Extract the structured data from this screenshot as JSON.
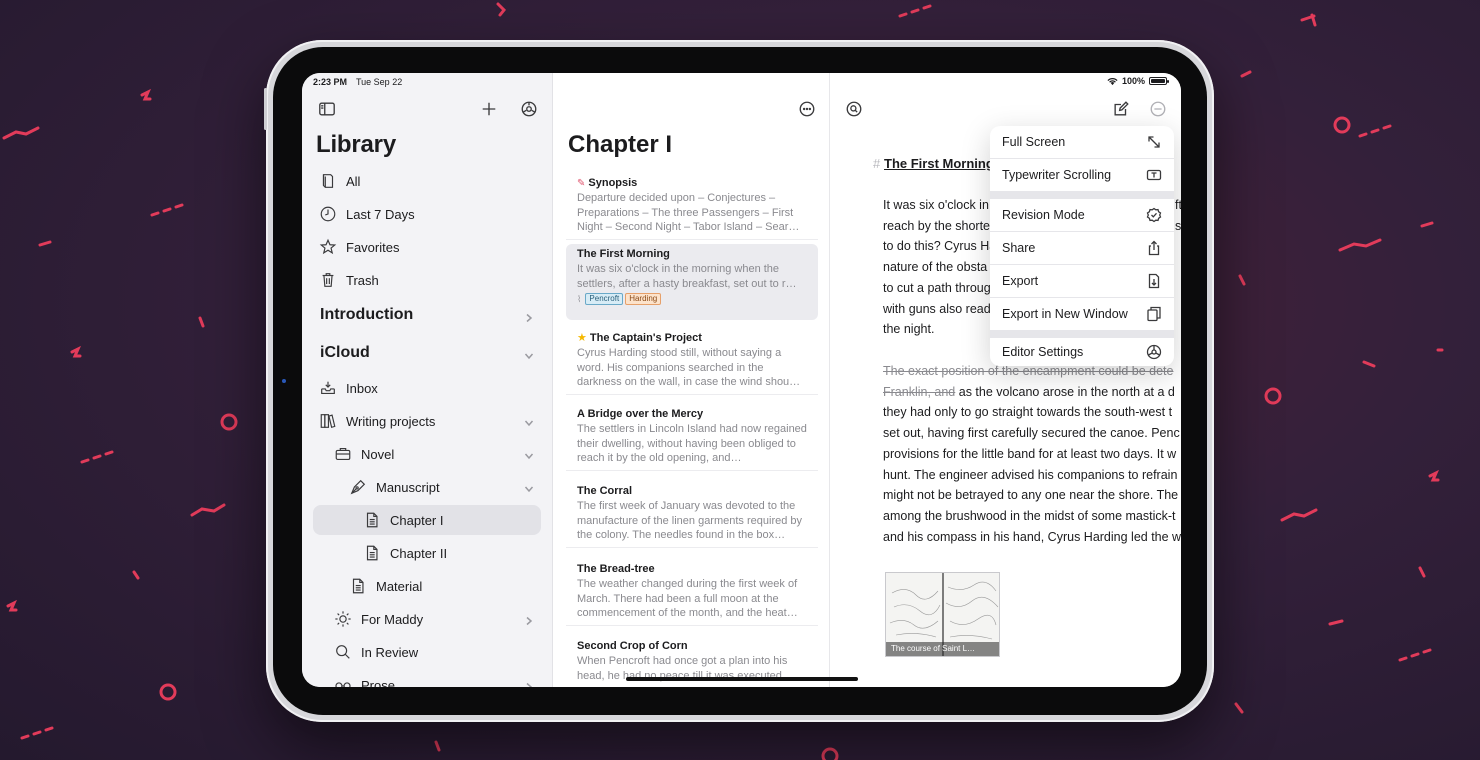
{
  "status_bar": {
    "time": "2:23 PM",
    "date": "Tue Sep 22",
    "battery": "100%"
  },
  "sidebar": {
    "title": "Library",
    "items": [
      {
        "label": "All",
        "icon": "book-icon"
      },
      {
        "label": "Last 7 Days",
        "icon": "clock-icon"
      },
      {
        "label": "Favorites",
        "icon": "star-icon"
      },
      {
        "label": "Trash",
        "icon": "trash-icon"
      },
      {
        "label": "Introduction",
        "icon": ""
      },
      {
        "label": "iCloud",
        "icon": ""
      },
      {
        "label": "Inbox",
        "icon": "inbox-icon"
      },
      {
        "label": "Writing projects",
        "icon": "books-icon"
      },
      {
        "label": "Novel",
        "icon": "briefcase-icon"
      },
      {
        "label": "Manuscript",
        "icon": "pen-nib-icon"
      },
      {
        "label": "Chapter I",
        "icon": "document-icon"
      },
      {
        "label": "Chapter II",
        "icon": "document-icon"
      },
      {
        "label": "Material",
        "icon": "document-icon"
      },
      {
        "label": "For Maddy",
        "icon": "sun-icon"
      },
      {
        "label": "In Review",
        "icon": "search-icon"
      },
      {
        "label": "Prose",
        "icon": "glasses-icon"
      }
    ]
  },
  "list": {
    "title": "Chapter I",
    "docs": [
      {
        "title": "Synopsis",
        "preview": "Departure decided upon – Conjectures – Preparations – The three Passengers – First Night – Second Night – Tabor Island – Sear…"
      },
      {
        "title": "The First Morning",
        "preview": "It was six o'clock in the morning when the settlers, after a hasty breakfast, set out to r…",
        "tags": [
          "Pencroft",
          "Harding"
        ]
      },
      {
        "title": "The Captain's Project",
        "preview": "Cyrus Harding stood still, without saying a word. His companions searched in the darkness on the wall, in case the wind shou…"
      },
      {
        "title": "A Bridge over the Mercy",
        "preview": "The settlers in Lincoln Island had now regained their dwelling, without having been obliged to reach it by the old opening, and…"
      },
      {
        "title": "The Corral",
        "preview": "The first week of January was devoted to the manufacture of the linen garments required by the colony. The needles found in the box…"
      },
      {
        "title": "The Bread-tree",
        "preview": "The weather changed during the first week of March. There had been a full moon at the commencement of the month, and the heat…"
      },
      {
        "title": "Second Crop of Corn",
        "preview": "When Pencroft had once got a plan into his head, he had no peace till it was executed."
      }
    ]
  },
  "editor": {
    "heading_marker": "#",
    "heading": "The First Morning",
    "para1": [
      "It was six o'clock in",
      "reach by the shorte",
      "to do this? Cyrus Ha",
      "nature of the obsta",
      "to cut a path throug",
      "with guns also read",
      "the night."
    ],
    "para1_right": [
      "ft",
      "",
      "",
      "",
      "s",
      "",
      ""
    ],
    "para2_strike_1": "The exact position of the encampment could be dete",
    "para2_strike_2": "Franklin, and",
    "para2_after": "as the volcano arose in the north at a d",
    "para2": [
      "they had only to go straight towards the south-west t",
      "set out, having first carefully secured the canoe. Penc",
      "provisions for the little band for at least two days. It w",
      "hunt. The engineer advised his companions to refrain",
      "might not be betrayed to any one near the shore. The",
      "among the brushwood in the midst of some mastick-t",
      "and his compass in his hand, Cyrus Harding led the w"
    ],
    "image_caption": "The course of Saint L…"
  },
  "menu": {
    "items": [
      {
        "label": "Full Screen",
        "icon": "expand-icon"
      },
      {
        "label": "Typewriter Scrolling",
        "icon": "typewriter-icon"
      },
      {
        "label": "Revision Mode",
        "icon": "checkmark-seal-icon"
      },
      {
        "label": "Share",
        "icon": "share-icon"
      },
      {
        "label": "Export",
        "icon": "export-doc-icon"
      },
      {
        "label": "Export in New Window",
        "icon": "new-window-icon"
      },
      {
        "label": "Editor Settings",
        "icon": "settings-icon"
      }
    ]
  }
}
